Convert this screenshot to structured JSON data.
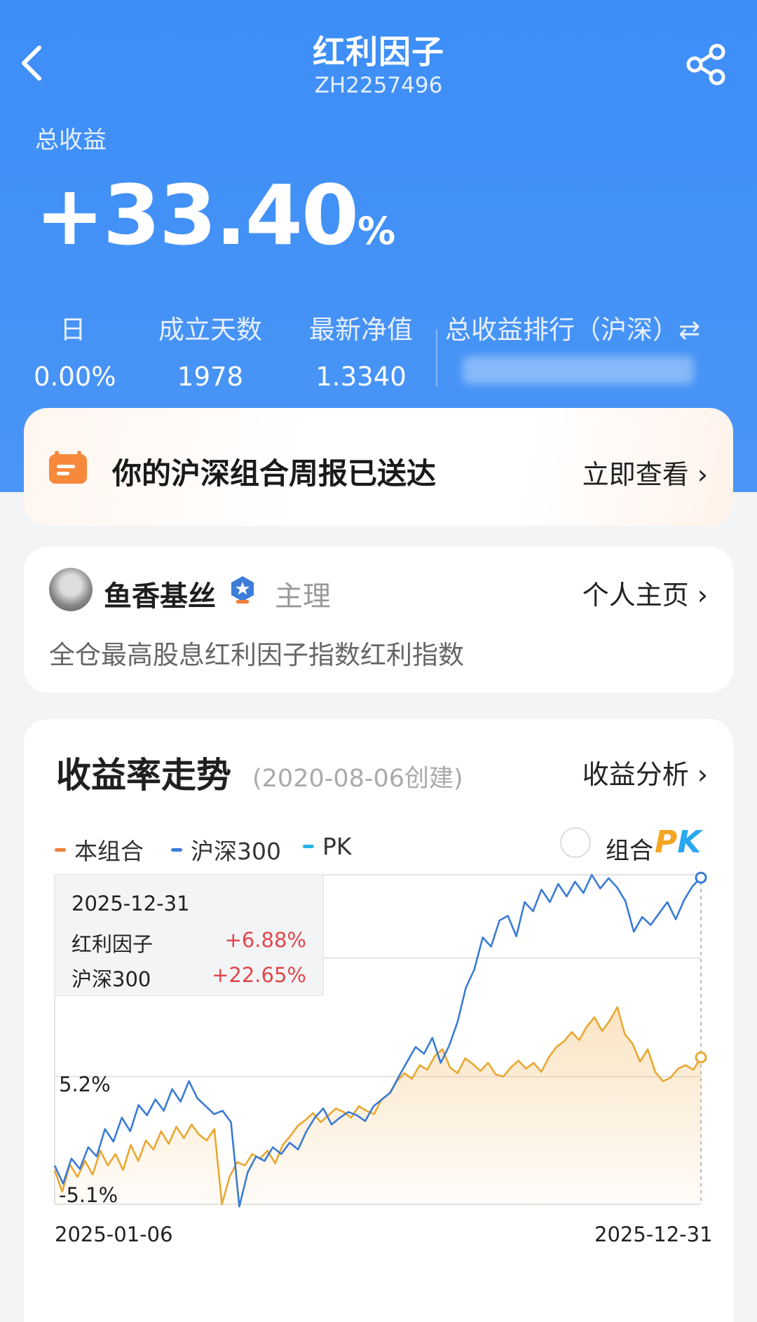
{
  "header": {
    "title": "红利因子",
    "code": "ZH2257496"
  },
  "total_return": {
    "label": "总收益",
    "value": "+33.40",
    "unit": "%"
  },
  "stats": [
    {
      "label": "日",
      "value": "0.00%"
    },
    {
      "label": "成立天数",
      "value": "1978"
    },
    {
      "label": "最新净值",
      "value": "1.3340"
    }
  ],
  "rank": {
    "label": "总收益排行（沪深）⇄",
    "value_hidden": true
  },
  "report": {
    "text": "你的沪深组合周报已送达",
    "link": "立即查看 ›"
  },
  "manager": {
    "name": "鱼香基丝",
    "role": "主理",
    "link": "个人主页 ›",
    "description": "全仓最高股息红利因子指数红利指数"
  },
  "chart_section": {
    "title": "收益率走势",
    "created": "(2020-08-06创建)",
    "link": "收益分析 ›",
    "legend": [
      {
        "label": "本组合",
        "color": "#f07f3a"
      },
      {
        "label": "沪深300",
        "color": "#3d7dd8"
      },
      {
        "label": "PK",
        "color": "#2bb4e8"
      }
    ],
    "pk_label": "组合",
    "pk_p": "P",
    "pk_k": "K"
  },
  "tooltip": {
    "date": "2025-12-31",
    "rows": [
      {
        "name": "红利因子",
        "value": "+6.88%"
      },
      {
        "name": "沪深300",
        "value": "+22.65%"
      }
    ]
  },
  "chart_data": {
    "type": "line",
    "x_start": "2025-01-06",
    "x_end": "2025-12-31",
    "y_labels": [
      "5.2%",
      "-5.1%"
    ],
    "ylim": [
      -6.0,
      22.9
    ],
    "series": [
      {
        "name": "红利因子",
        "color": "#e8a831",
        "values": [
          -3.0,
          -4.9,
          -2.5,
          -3.6,
          -2.2,
          -3.4,
          -1.3,
          -2.6,
          -1.6,
          -3.0,
          -0.8,
          -2.2,
          -0.4,
          -1.2,
          0.4,
          -0.7,
          0.8,
          -0.2,
          1.0,
          0.1,
          -0.4,
          0.6,
          -6.0,
          -3.6,
          -2.3,
          -2.6,
          -1.6,
          -2.0,
          -1.3,
          -2.4,
          -0.8,
          0.0,
          0.9,
          1.4,
          2.0,
          1.2,
          1.8,
          2.4,
          2.1,
          1.6,
          2.6,
          2.2,
          1.9,
          3.2,
          3.7,
          4.8,
          5.5,
          5.0,
          6.2,
          5.8,
          7.0,
          7.6,
          6.0,
          5.5,
          6.8,
          6.3,
          5.7,
          6.4,
          5.4,
          5.2,
          6.0,
          6.6,
          5.9,
          6.4,
          5.6,
          6.9,
          7.8,
          8.3,
          9.1,
          8.4,
          9.6,
          10.4,
          9.2,
          10.1,
          11.3,
          8.9,
          8.1,
          6.5,
          7.6,
          5.6,
          4.8,
          5.1,
          5.9,
          6.2,
          5.8,
          6.88
        ]
      },
      {
        "name": "沪深300",
        "color": "#3a7bd5",
        "values": [
          -2.6,
          -4.2,
          -2.0,
          -2.9,
          -1.0,
          -1.8,
          0.6,
          -0.5,
          1.6,
          0.4,
          2.7,
          1.8,
          3.2,
          2.2,
          4.1,
          3.0,
          4.8,
          3.3,
          2.6,
          1.9,
          2.2,
          1.2,
          -6.2,
          -3.2,
          -1.8,
          -2.2,
          -1.0,
          -1.6,
          -0.6,
          -1.2,
          0.4,
          1.6,
          2.4,
          1.0,
          1.6,
          2.1,
          1.8,
          1.3,
          2.6,
          3.2,
          3.8,
          5.2,
          6.5,
          7.8,
          7.2,
          8.6,
          6.4,
          7.9,
          10.0,
          13.0,
          14.6,
          17.4,
          16.6,
          18.9,
          19.3,
          17.5,
          20.5,
          19.7,
          21.6,
          20.5,
          22.1,
          21.0,
          22.3,
          21.3,
          22.9,
          21.7,
          22.6,
          21.8,
          20.6,
          17.9,
          19.2,
          18.5,
          19.5,
          20.5,
          19.0,
          20.7,
          21.9,
          22.65
        ]
      }
    ]
  }
}
